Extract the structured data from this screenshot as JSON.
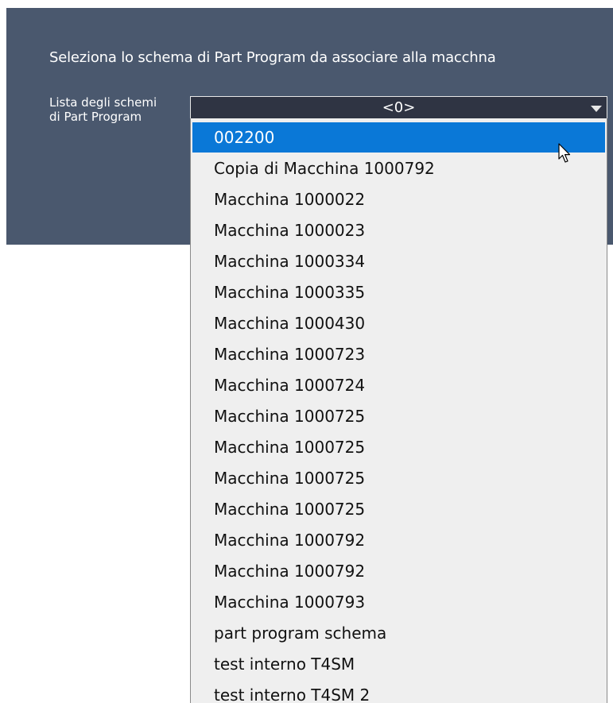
{
  "dialog": {
    "instruction": "Seleziona lo schema di Part Program da associare alla macchna",
    "field_label_line1": "Lista degli schemi",
    "field_label_line2": "di Part Program"
  },
  "combo": {
    "selected_value": "<0>",
    "arrow_icon": "chevron-down-icon"
  },
  "dropdown": {
    "highlighted_index": 0,
    "options": [
      "002200",
      "Copia di Macchina 1000792",
      "Macchina 1000022",
      "Macchina 1000023",
      "Macchina 1000334",
      "Macchina 1000335",
      "Macchina 1000430",
      "Macchina 1000723",
      "Macchina 1000724",
      "Macchina 1000725",
      "Macchina 1000725",
      "Macchina 1000725",
      "Macchina 1000725",
      "Macchina 1000792",
      "Macchina 1000792",
      "Macchina 1000793",
      "part program schema",
      "test interno T4SM",
      "test interno T4SM 2"
    ]
  },
  "colors": {
    "panel_background": "#4a586e",
    "combo_background": "#2f3443",
    "dropdown_background": "#efefef",
    "highlight": "#0a78d7"
  }
}
